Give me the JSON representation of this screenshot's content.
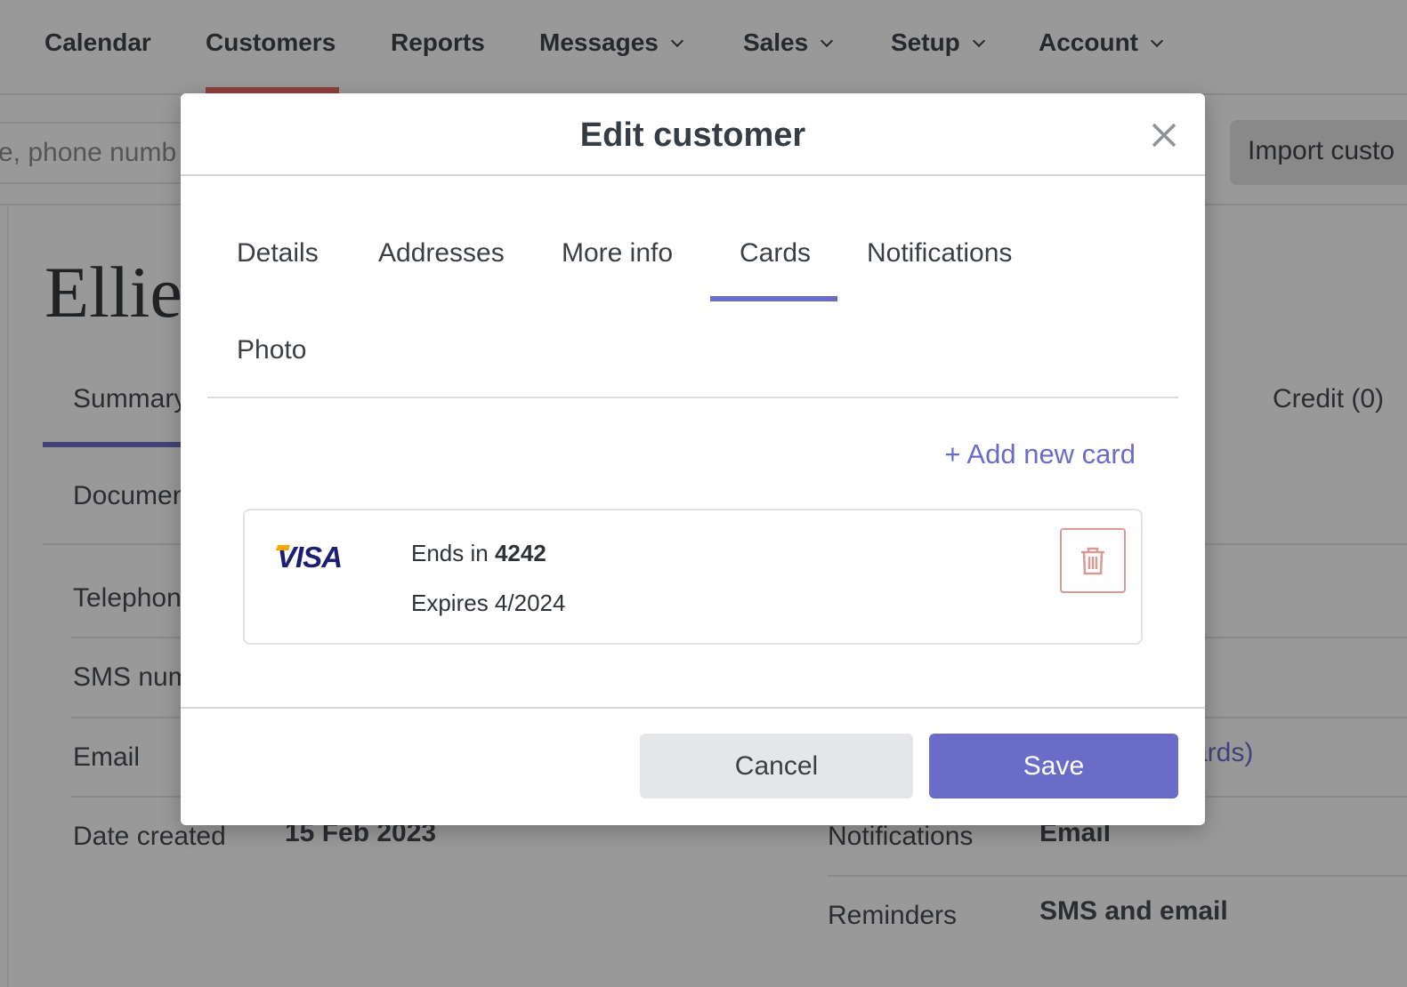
{
  "nav": {
    "items": [
      {
        "label": "Calendar"
      },
      {
        "label": "Customers"
      },
      {
        "label": "Reports"
      },
      {
        "label": "Messages"
      },
      {
        "label": "Sales"
      },
      {
        "label": "Setup"
      },
      {
        "label": "Account"
      }
    ],
    "active": "Customers",
    "accent": "#8f3e3e"
  },
  "search": {
    "placeholder": "e, phone numb"
  },
  "import_button": "Import custo",
  "customer": {
    "name": "Ellie"
  },
  "page_tabs": {
    "summary": "Summary",
    "documents": "Documen",
    "partial": ")",
    "credit": "Credit (0)"
  },
  "details": {
    "telephone": "Telephon",
    "sms": "SMS num",
    "email": "Email",
    "date_created_label": "Date created",
    "date_created_value": "15 Feb 2023",
    "cards_link": "ards)",
    "notifications_label": "Notifications",
    "notifications_value": "Email",
    "reminders_label": "Reminders",
    "reminders_value": "SMS and email"
  },
  "modal": {
    "title": "Edit customer",
    "tabs": [
      {
        "label": "Details"
      },
      {
        "label": "Addresses"
      },
      {
        "label": "More info"
      },
      {
        "label": "Cards"
      },
      {
        "label": "Notifications"
      },
      {
        "label": "Photo"
      }
    ],
    "active_tab": "Cards",
    "add_card": "+ Add new card",
    "card": {
      "brand": "VISA",
      "ends_prefix": "Ends in ",
      "last4": "4242",
      "expires": "Expires 4/2024"
    },
    "cancel": "Cancel",
    "save": "Save",
    "accent": "#6b6cc8"
  }
}
